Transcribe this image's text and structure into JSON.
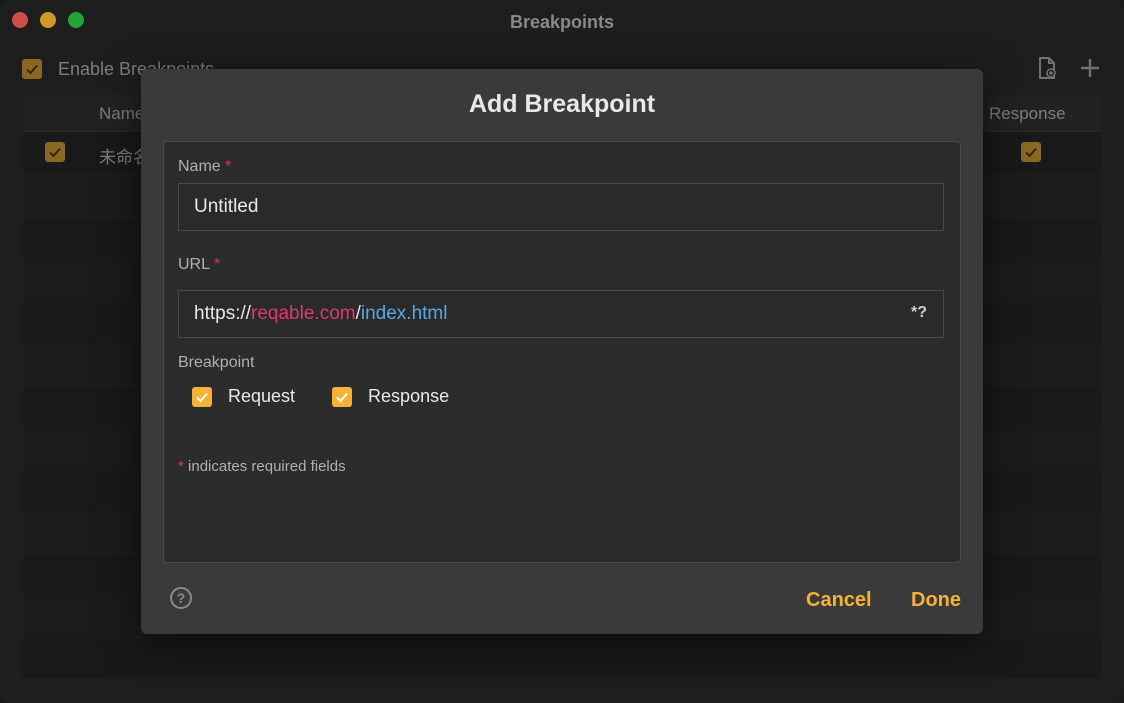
{
  "window": {
    "title": "Breakpoints"
  },
  "toolbar": {
    "enable_label": "Enable Breakpoints",
    "import_icon": "file-import-icon",
    "add_icon": "plus-icon"
  },
  "table": {
    "columns": [
      "Name",
      "Response"
    ],
    "rows": [
      {
        "name": "未命名",
        "enabled": true,
        "response": true
      }
    ]
  },
  "dialog": {
    "title": "Add Breakpoint",
    "name_label": "Name",
    "required_mark": "*",
    "name_value": "Untitled",
    "url_label": "URL",
    "url_value": {
      "scheme": "https://",
      "host": "reqable.com",
      "slash": "/",
      "path": "index.html"
    },
    "regex_label": "*?",
    "breakpoint_label": "Breakpoint",
    "options": [
      {
        "label": "Request",
        "checked": true
      },
      {
        "label": "Response",
        "checked": true
      }
    ],
    "required_note": "indicates required fields",
    "help_icon": "question-circle-icon",
    "cancel_label": "Cancel",
    "done_label": "Done"
  },
  "colors": {
    "accent": "#f6b234",
    "required": "#e0364a",
    "url_host": "#e0396b",
    "url_path": "#58a6e6"
  }
}
